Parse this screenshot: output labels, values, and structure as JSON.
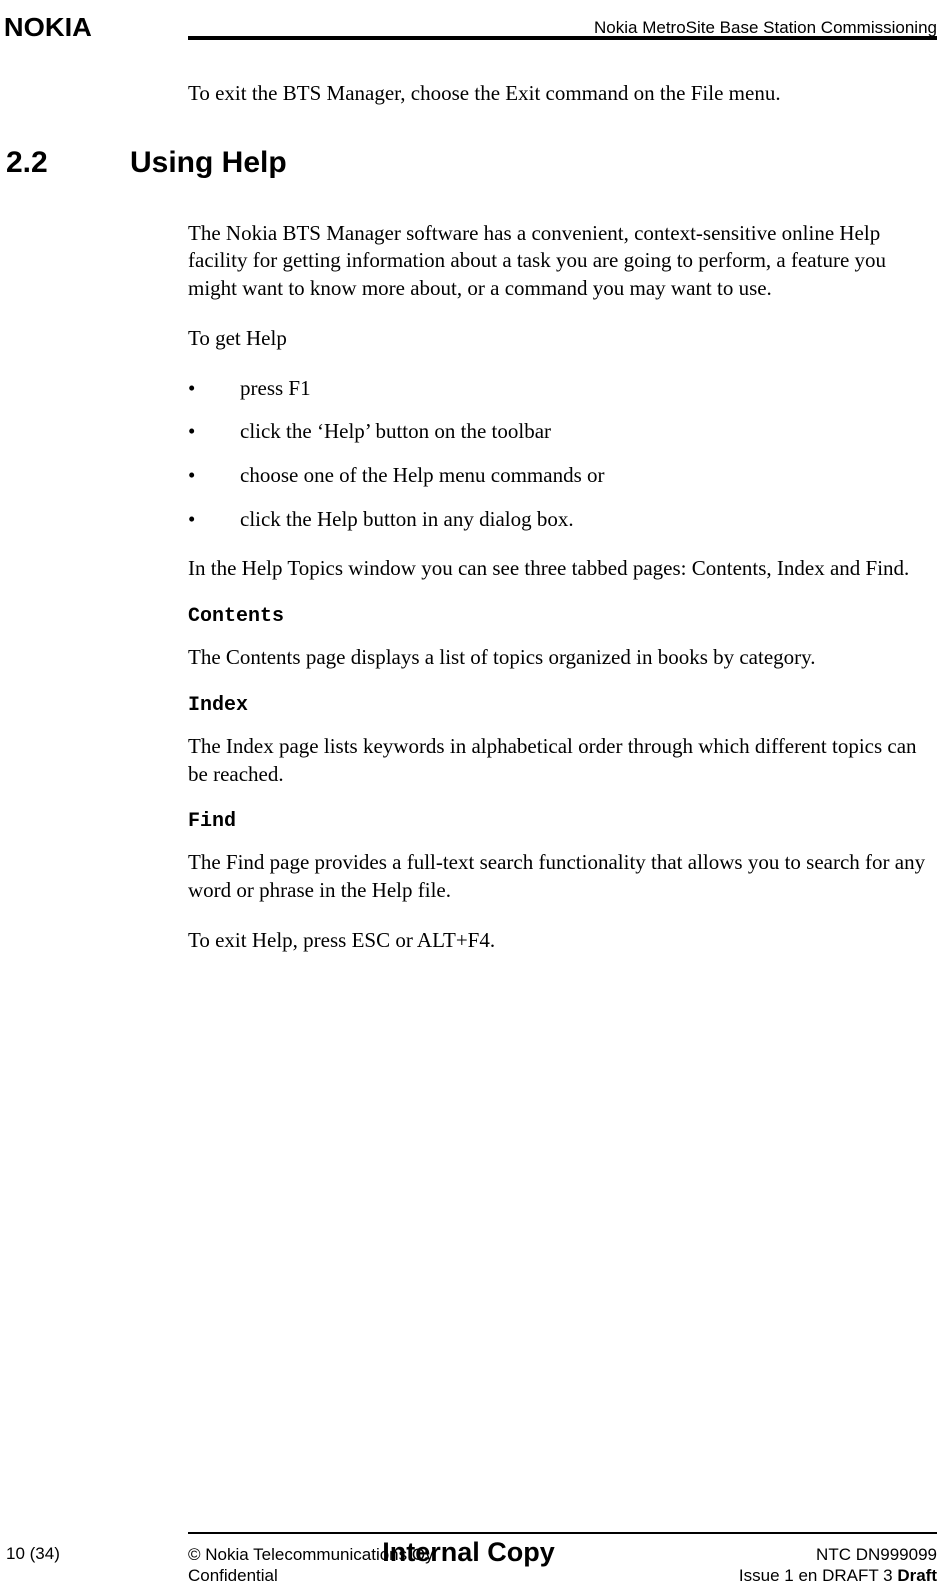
{
  "header": {
    "logo_text": "NOKIA",
    "doc_title": "Nokia MetroSite Base Station Commissioning"
  },
  "body": {
    "intro_para": "To exit the BTS Manager, choose the Exit command on the File menu.",
    "section": {
      "number": "2.2",
      "title": "Using Help",
      "p1": "The Nokia BTS Manager software has a convenient, context-sensitive online Help facility for getting information about a task you are going to perform, a feature you might want to know more about, or a command you may want to use.",
      "p2": "To get Help",
      "bullets": [
        "press F1",
        "click the ‘Help’ button on the toolbar",
        "choose one of the Help menu commands or",
        "click the Help button in any dialog box."
      ],
      "p3": "In the Help Topics window you can see three tabbed pages: Contents, Index and Find.",
      "subs": [
        {
          "head": "Contents",
          "text": "The Contents page displays a list of topics organized in books by category."
        },
        {
          "head": "Index",
          "text": "The Index page lists keywords in alphabetical order through which different topics can be reached."
        },
        {
          "head": "Find",
          "text": "The Find page provides a full-text search functionality that allows you to search for any word or phrase in the Help file."
        }
      ],
      "p4": "To exit Help, press ESC or ALT+F4."
    }
  },
  "footer": {
    "page_num": "10 (34)",
    "copyright": "© Nokia Telecommunications Oy",
    "confidential": "Confidential",
    "center": "Internal Copy",
    "code": "NTC DN999099",
    "issue_prefix": "Issue 1 en DRAFT 3 ",
    "issue_bold": "Draft"
  }
}
